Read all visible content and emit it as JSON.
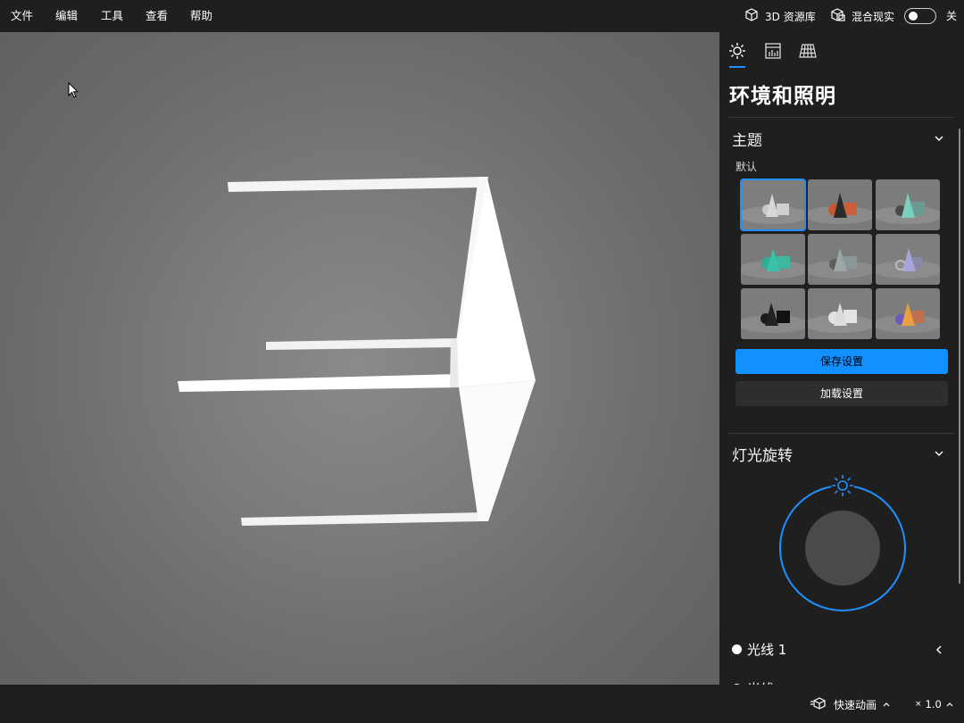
{
  "menu": {
    "file": "文件",
    "edit": "编辑",
    "tools": "工具",
    "view": "查看",
    "help": "帮助"
  },
  "header": {
    "library": "3D 资源库",
    "mixed_reality": "混合现实",
    "mixed_reality_state": "关"
  },
  "panel": {
    "title": "环境和照明",
    "theme_section": "主题",
    "theme_default": "默认",
    "save_button": "保存设置",
    "load_button": "加载设置",
    "light_rotation_section": "灯光旋转",
    "light1": "光线 1",
    "light2": "光线"
  },
  "bottom": {
    "quick_animation": "快速动画",
    "speed": "1.0"
  },
  "colors": {
    "accent": "#1290ff",
    "panel_bg": "#1f1f1f"
  },
  "icons": [
    "sun-icon",
    "stats-icon",
    "grid-icon",
    "cube-icon",
    "mixed-reality-icon",
    "chevron-down-icon",
    "chevron-left-icon",
    "cursor-icon"
  ]
}
